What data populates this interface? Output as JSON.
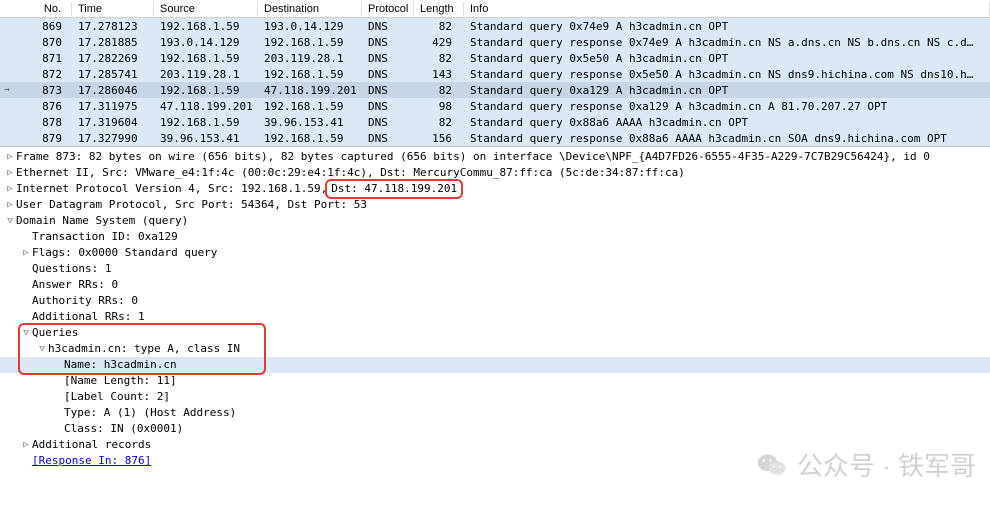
{
  "columns": {
    "no": "No.",
    "time": "Time",
    "source": "Source",
    "destination": "Destination",
    "protocol": "Protocol",
    "length": "Length",
    "info": "Info"
  },
  "packets": [
    {
      "no": "869",
      "time": "17.278123",
      "src": "192.168.1.59",
      "dst": "193.0.14.129",
      "proto": "DNS",
      "len": "82",
      "info": "Standard query 0x74e9 A h3cadmin.cn OPT",
      "style": "highlighted"
    },
    {
      "no": "870",
      "time": "17.281885",
      "src": "193.0.14.129",
      "dst": "192.168.1.59",
      "proto": "DNS",
      "len": "429",
      "info": "Standard query response 0x74e9 A h3cadmin.cn NS a.dns.cn NS b.dns.cn NS c.d…",
      "style": "highlighted"
    },
    {
      "no": "871",
      "time": "17.282269",
      "src": "192.168.1.59",
      "dst": "203.119.28.1",
      "proto": "DNS",
      "len": "82",
      "info": "Standard query 0x5e50 A h3cadmin.cn OPT",
      "style": "highlighted"
    },
    {
      "no": "872",
      "time": "17.285741",
      "src": "203.119.28.1",
      "dst": "192.168.1.59",
      "proto": "DNS",
      "len": "143",
      "info": "Standard query response 0x5e50 A h3cadmin.cn NS dns9.hichina.com NS dns10.h…",
      "style": "highlighted"
    },
    {
      "no": "873",
      "time": "17.286046",
      "src": "192.168.1.59",
      "dst": "47.118.199.201",
      "proto": "DNS",
      "len": "82",
      "info": "Standard query 0xa129 A h3cadmin.cn OPT",
      "style": "selected"
    },
    {
      "no": "876",
      "time": "17.311975",
      "src": "47.118.199.201",
      "dst": "192.168.1.59",
      "proto": "DNS",
      "len": "98",
      "info": "Standard query response 0xa129 A h3cadmin.cn A 81.70.207.27 OPT",
      "style": "highlighted"
    },
    {
      "no": "878",
      "time": "17.319604",
      "src": "192.168.1.59",
      "dst": "39.96.153.41",
      "proto": "DNS",
      "len": "82",
      "info": "Standard query 0x88a6 AAAA h3cadmin.cn OPT",
      "style": "highlighted"
    },
    {
      "no": "879",
      "time": "17.327990",
      "src": "39.96.153.41",
      "dst": "192.168.1.59",
      "proto": "DNS",
      "len": "156",
      "info": "Standard query response 0x88a6 AAAA h3cadmin.cn SOA dns9.hichina.com OPT",
      "style": "highlighted"
    }
  ],
  "details": {
    "frame": "Frame 873: 82 bytes on wire (656 bits), 82 bytes captured (656 bits) on interface \\Device\\NPF_{A4D7FD26-6555-4F35-A229-7C7B29C56424}, id 0",
    "eth": "Ethernet II, Src: VMware_e4:1f:4c (00:0c:29:e4:1f:4c), Dst: MercuryCommu_87:ff:ca (5c:de:34:87:ff:ca)",
    "ip_pre": "Internet Protocol Version 4, Src: 192.168.1.59, ",
    "ip_dst": "Dst: 47.118.199.201",
    "udp": "User Datagram Protocol, Src Port: 54364, Dst Port: 53",
    "dns": "Domain Name System (query)",
    "txid": "Transaction ID: 0xa129",
    "flags": "Flags: 0x0000 Standard query",
    "questions": "Questions: 1",
    "answer": "Answer RRs: 0",
    "authority": "Authority RRs: 0",
    "additional": "Additional RRs: 1",
    "queries": "Queries",
    "query_item": "h3cadmin.cn: type A, class IN",
    "name": "Name: h3cadmin.cn",
    "name_len": "[Name Length: 11]",
    "label_count": "[Label Count: 2]",
    "type": "Type: A (1) (Host Address)",
    "class": "Class: IN (0x0001)",
    "addl": "Additional records",
    "resp_in": "[Response In: 876]"
  },
  "watermark": "公众号 · 铁军哥"
}
